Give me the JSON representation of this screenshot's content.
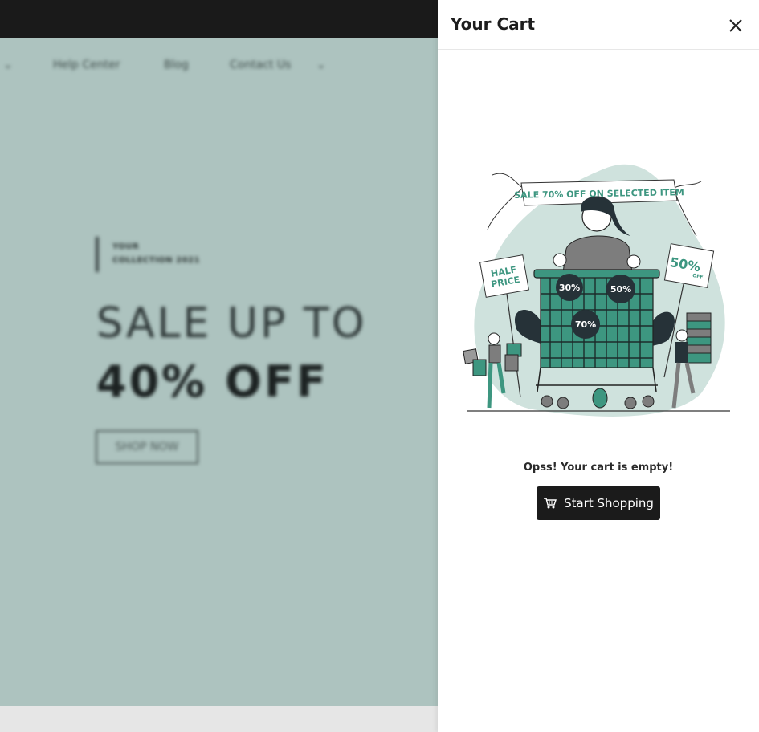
{
  "background_page": {
    "nav": {
      "items": [
        "Help Center",
        "Blog",
        "Contact Us"
      ]
    },
    "hero": {
      "tag_line1": "YOUR",
      "tag_line2": "COLLECTION 2021",
      "headline1": "SALE UP TO",
      "headline2": "40% OFF",
      "cta": "SHOP NOW"
    }
  },
  "cart_drawer": {
    "title": "Your Cart",
    "illustration": {
      "banner": "SALE 70% OFF ON SELECTED ITEM",
      "sign_left_line1": "HALF",
      "sign_left_line2": "PRICE",
      "sign_right": "50%",
      "sign_right_sub": "OFF",
      "badge_1": "30%",
      "badge_2": "50%",
      "badge_3": "70%"
    },
    "empty_message": "Opss! Your cart is empty!",
    "start_button": "Start Shopping"
  },
  "colors": {
    "hero_bg": "#adc3bf",
    "accent_teal": "#3d9680",
    "blob": "#cfe2dd",
    "button_dark": "#1b1b1b"
  }
}
